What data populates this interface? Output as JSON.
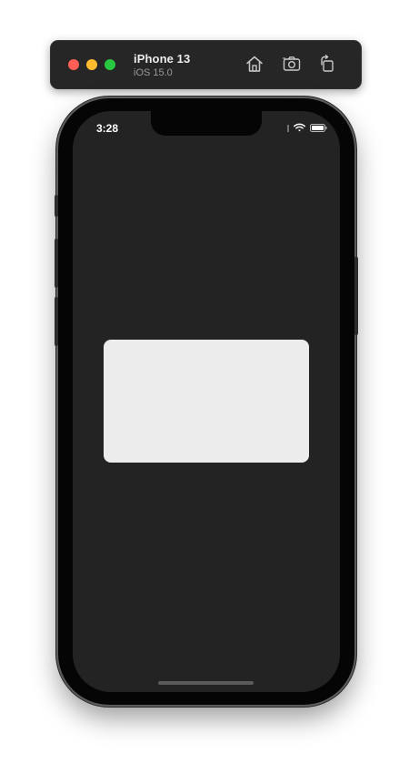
{
  "toolbar": {
    "traffic_lights": {
      "close_color": "#ff5f57",
      "minimize_color": "#febc2e",
      "zoom_color": "#28c840"
    },
    "device_name": "iPhone 13",
    "os_version": "iOS 15.0",
    "icons": [
      "home-icon",
      "screenshot-icon",
      "rotate-icon"
    ]
  },
  "device": {
    "status_bar": {
      "time": "3:28",
      "icons": [
        "signal-dots-icon",
        "wifi-icon",
        "battery-icon"
      ]
    },
    "screen_background": "#232323",
    "card_color": "#ececec"
  }
}
